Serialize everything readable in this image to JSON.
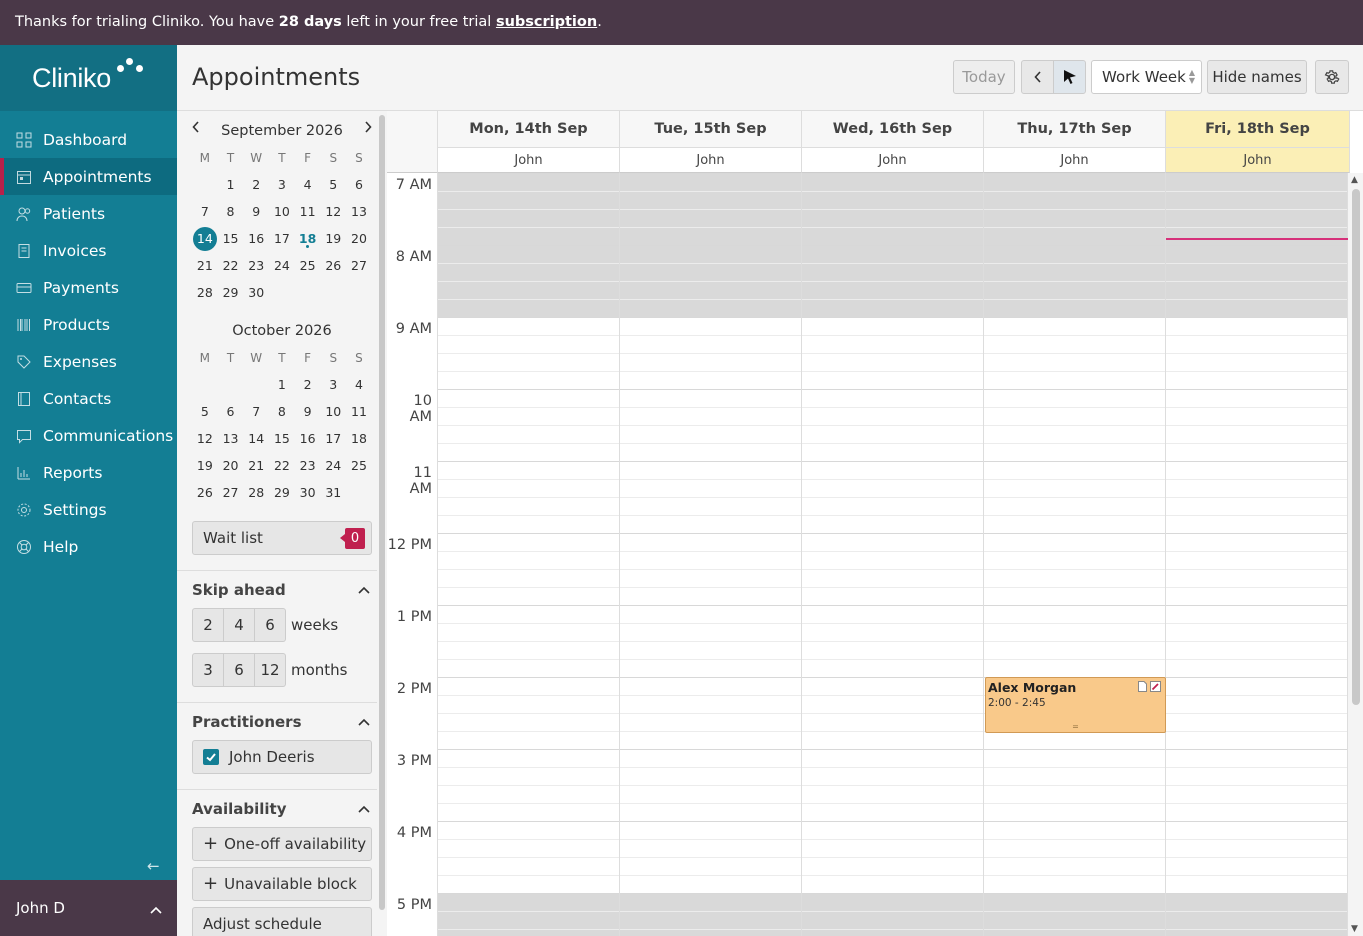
{
  "banner": {
    "prefix": "Thanks for trialing Cliniko. You have ",
    "days": "28 days",
    "middle": " left in your free trial ",
    "link": "subscription",
    "suffix": "."
  },
  "app": {
    "logo": "Cliniko"
  },
  "sidebar": {
    "items": [
      {
        "label": "Dashboard",
        "icon": "dashboard-icon",
        "active": false
      },
      {
        "label": "Appointments",
        "icon": "calendar-icon",
        "active": true
      },
      {
        "label": "Patients",
        "icon": "patients-icon",
        "active": false
      },
      {
        "label": "Invoices",
        "icon": "invoice-icon",
        "active": false
      },
      {
        "label": "Payments",
        "icon": "card-icon",
        "active": false
      },
      {
        "label": "Products",
        "icon": "barcode-icon",
        "active": false
      },
      {
        "label": "Expenses",
        "icon": "tag-icon",
        "active": false
      },
      {
        "label": "Contacts",
        "icon": "contacts-icon",
        "active": false
      },
      {
        "label": "Communications",
        "icon": "chat-icon",
        "active": false
      },
      {
        "label": "Reports",
        "icon": "chart-icon",
        "active": false
      },
      {
        "label": "Settings",
        "icon": "gear-icon",
        "active": false
      },
      {
        "label": "Help",
        "icon": "lifebuoy-icon",
        "active": false
      }
    ],
    "user": "John D"
  },
  "header": {
    "title": "Appointments",
    "today": "Today",
    "view": "Work Week",
    "hide_names": "Hide names"
  },
  "mini_calendars": [
    {
      "title": "September 2026",
      "dow": [
        "M",
        "T",
        "W",
        "T",
        "F",
        "S",
        "S"
      ],
      "offset": 1,
      "days": 30,
      "selected": 14,
      "today": 18
    },
    {
      "title": "October 2026",
      "dow": [
        "M",
        "T",
        "W",
        "T",
        "F",
        "S",
        "S"
      ],
      "offset": 3,
      "days": 31,
      "selected": null,
      "today": null
    }
  ],
  "wait_list": {
    "label": "Wait list",
    "count": "0"
  },
  "skip_ahead": {
    "title": "Skip ahead",
    "weeks": [
      "2",
      "4",
      "6"
    ],
    "weeks_label": "weeks",
    "months": [
      "3",
      "6",
      "12"
    ],
    "months_label": "months"
  },
  "practitioners": {
    "title": "Practitioners",
    "items": [
      {
        "name": "John Deeris",
        "checked": true
      }
    ]
  },
  "availability": {
    "title": "Availability",
    "one_off": "One-off availability",
    "unavailable": "Unavailable block",
    "adjust": "Adjust schedule"
  },
  "calendar": {
    "days": [
      {
        "label": "Mon, 14th Sep",
        "practitioner": "John",
        "highlight": false
      },
      {
        "label": "Tue, 15th Sep",
        "practitioner": "John",
        "highlight": false
      },
      {
        "label": "Wed, 16th Sep",
        "practitioner": "John",
        "highlight": false
      },
      {
        "label": "Thu, 17th Sep",
        "practitioner": "John",
        "highlight": false
      },
      {
        "label": "Fri, 18th Sep",
        "practitioner": "John",
        "highlight": true
      }
    ],
    "hours": [
      "7 AM",
      "8 AM",
      "9 AM",
      "10 AM",
      "11 AM",
      "12 PM",
      "1 PM",
      "2 PM",
      "3 PM",
      "4 PM",
      "5 PM"
    ],
    "appointments": [
      {
        "patient": "Alex Morgan",
        "time": "2:00 - 2:45",
        "day_index": 3
      }
    ]
  },
  "colors": {
    "brand": "#137e94",
    "banner": "#4a3848",
    "active_marker": "#b8204a",
    "appointment": "#f9c98a",
    "today_column": "#fbefb6",
    "now_line": "#d6317a"
  }
}
